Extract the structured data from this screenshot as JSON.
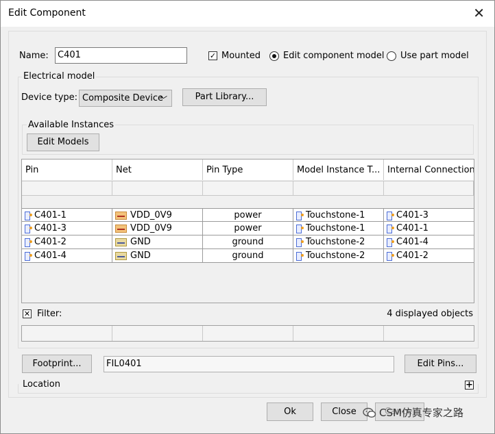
{
  "window": {
    "title": "Edit Component",
    "close_glyph": "✕"
  },
  "name_field": {
    "label": "Name:",
    "value": "C401"
  },
  "mounted": {
    "label": "Mounted",
    "checked": true,
    "mark": "✓"
  },
  "model_choice": {
    "edit_component_label": "Edit component model",
    "use_part_label": "Use part model",
    "selected": "edit_component"
  },
  "electrical": {
    "legend": "Electrical model",
    "device_type_label": "Device type:",
    "device_type_value": "Composite Device",
    "part_library_button": "Part Library..."
  },
  "instances": {
    "legend": "Available Instances",
    "edit_models_button": "Edit Models"
  },
  "table": {
    "columns": [
      "Pin",
      "Net",
      "Pin Type",
      "Model Instance T...",
      "Internal Connection"
    ],
    "rows": [
      {
        "pin": "C401-1",
        "net": "VDD_0V9",
        "net_kind": "power",
        "pin_type": "power",
        "model": "Touchstone-1",
        "internal": "C401-3"
      },
      {
        "pin": "C401-3",
        "net": "VDD_0V9",
        "net_kind": "power",
        "pin_type": "power",
        "model": "Touchstone-1",
        "internal": "C401-1"
      },
      {
        "pin": "C401-2",
        "net": "GND",
        "net_kind": "ground",
        "pin_type": "ground",
        "model": "Touchstone-2",
        "internal": "C401-4"
      },
      {
        "pin": "C401-4",
        "net": "GND",
        "net_kind": "ground",
        "pin_type": "ground",
        "model": "Touchstone-2",
        "internal": "C401-2"
      }
    ]
  },
  "filter": {
    "label": "Filter:",
    "mark": "✕",
    "count_text": "4 displayed objects"
  },
  "footprint": {
    "button": "Footprint...",
    "value": "FIL0401",
    "edit_pins_button": "Edit Pins..."
  },
  "location": {
    "label": "Location",
    "expand_glyph": "+"
  },
  "buttons": {
    "ok": "Ok",
    "close": "Close",
    "third": "Cancel"
  },
  "watermark": {
    "text": "CSM仿真专家之路"
  }
}
